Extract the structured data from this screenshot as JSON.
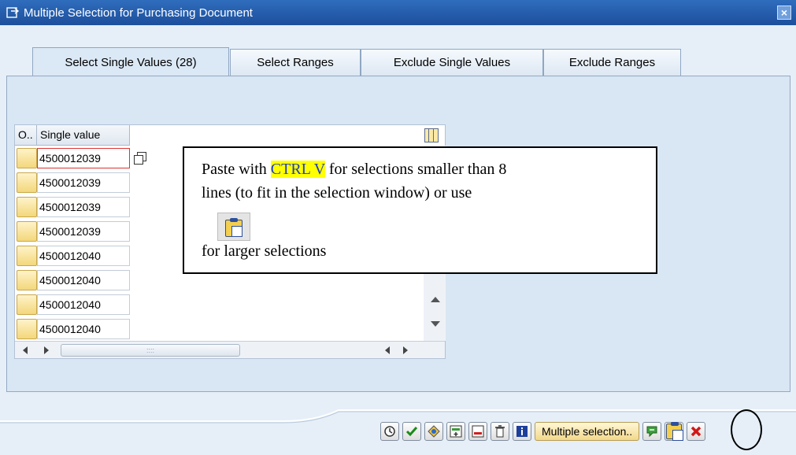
{
  "window": {
    "title": "Multiple Selection for Purchasing Document"
  },
  "tabs": [
    {
      "label": "Select Single Values (28)",
      "active": true
    },
    {
      "label": "Select Ranges",
      "active": false
    },
    {
      "label": "Exclude Single Values",
      "active": false
    },
    {
      "label": "Exclude Ranges",
      "active": false
    }
  ],
  "table": {
    "col_option": "O..",
    "col_value": "Single value",
    "rows": [
      "4500012039",
      "4500012039",
      "4500012039",
      "4500012039",
      "4500012040",
      "4500012040",
      "4500012040",
      "4500012040"
    ],
    "scroll_grip": "::::"
  },
  "callout": {
    "line1_before": "Paste with ",
    "line1_highlight": "CTRL V",
    "line1_after": " for selections smaller than 8",
    "line2": "lines (to fit in the selection window) or use",
    "line3": "for larger selections"
  },
  "toolbar": {
    "multiple_selection_label": "Multiple selection..",
    "buttons": [
      "execute-icon",
      "check-icon",
      "maintain-icon",
      "insert-line-icon",
      "delete-line-icon",
      "delete-all-icon",
      "info-icon",
      "multiple-selection",
      "import-icon",
      "paste-clipboard-icon",
      "cancel-icon"
    ]
  },
  "colors": {
    "titlebar": "#1c4f9c",
    "highlight": "#ffff00",
    "callout_highlight_text": "#1f3fbf",
    "cancel_red": "#d01818"
  }
}
